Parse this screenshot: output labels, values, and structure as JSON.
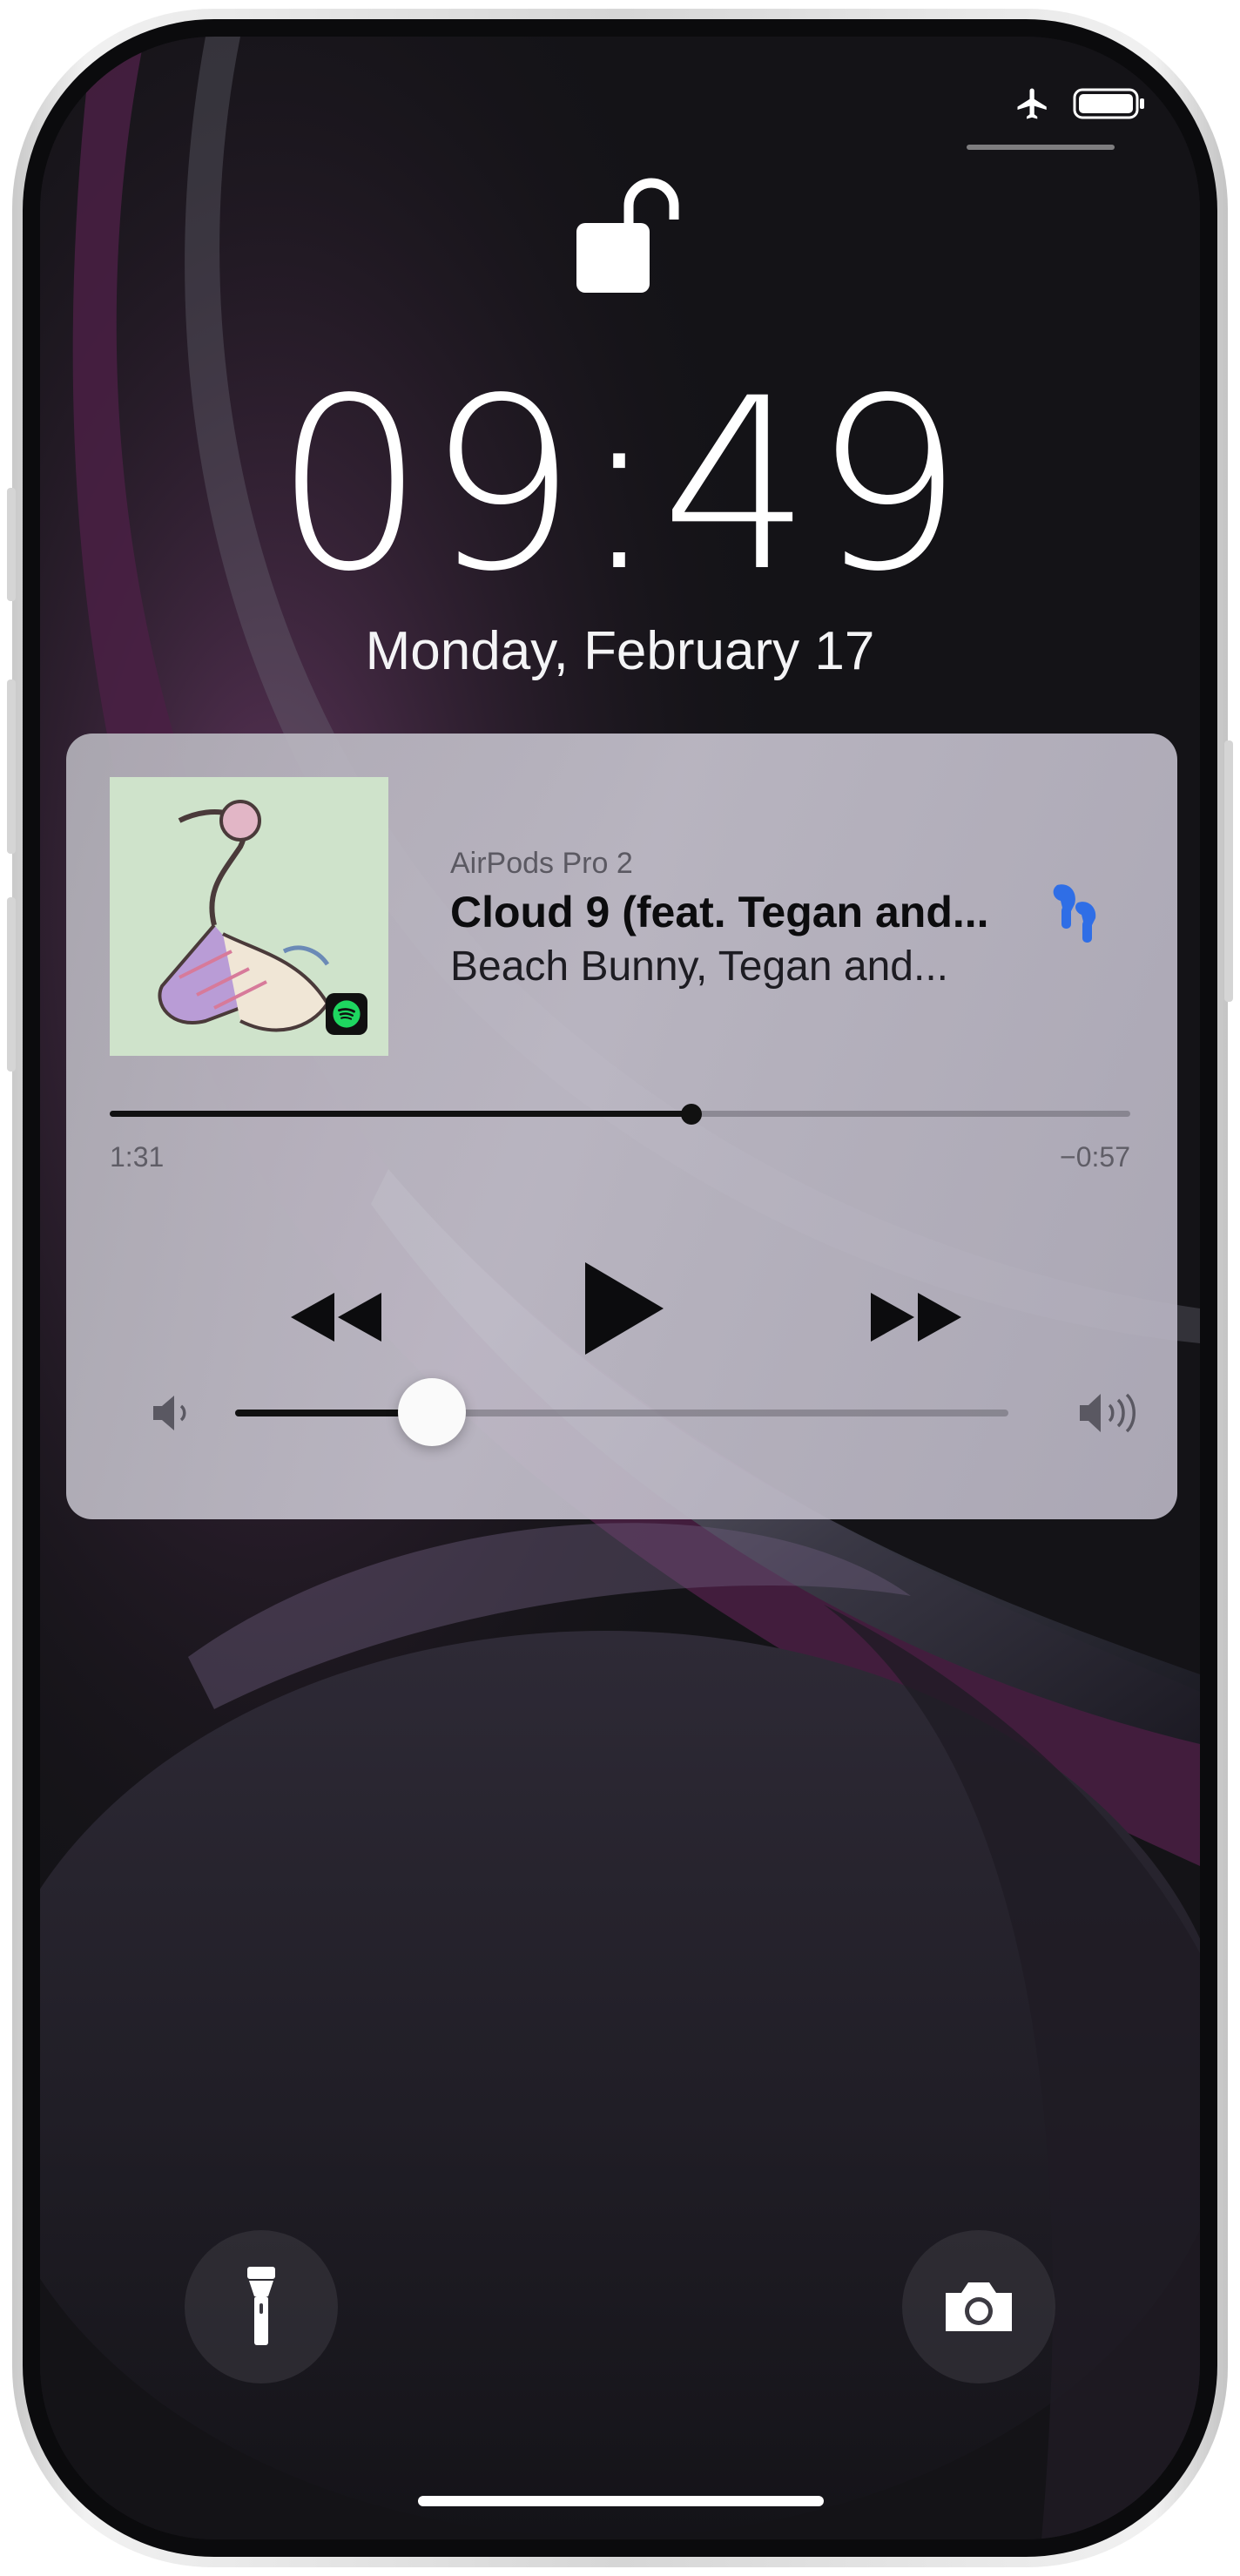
{
  "status_bar": {
    "airplane_icon": "airplane-icon",
    "battery_icon": "battery-icon"
  },
  "lock_screen": {
    "lock_icon": "unlocked-padlock-icon",
    "time": "09:49",
    "date": "Monday, February 17"
  },
  "now_playing": {
    "device": "AirPods Pro 2",
    "title": "Cloud 9 (feat. Tegan and...",
    "artist": "Beach Bunny, Tegan and...",
    "app_badge": "spotify-icon",
    "output_icon": "airpods-icon",
    "elapsed": "1:31",
    "remaining": "−0:57",
    "progress_fraction": 0.57,
    "volume_fraction": 0.255,
    "controls": {
      "rewind_icon": "rewind-icon",
      "play_icon": "play-icon",
      "forward_icon": "fast-forward-icon"
    },
    "volume_low_icon": "volume-low-icon",
    "volume_high_icon": "volume-high-icon"
  },
  "quick_actions": {
    "flashlight_icon": "flashlight-icon",
    "camera_icon": "camera-icon"
  },
  "colors": {
    "accent_airpods": "#2f6ee6",
    "spotify_green": "#1ed760",
    "artwork_bg": "#cfe3cb"
  }
}
